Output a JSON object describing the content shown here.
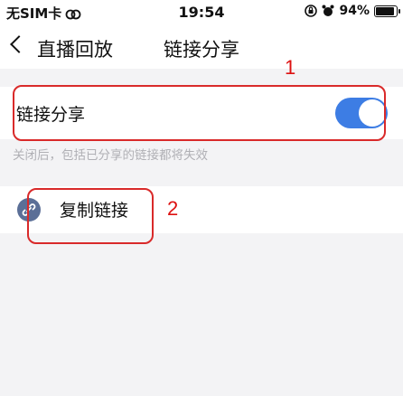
{
  "status_bar": {
    "carrier": "无SIM卡",
    "time": "19:54",
    "battery_percent": "94%",
    "battery_level": 0.94
  },
  "nav": {
    "back_label": "直播回放",
    "title": "链接分享"
  },
  "share": {
    "label": "链接分享",
    "enabled": true,
    "hint": "关闭后，包括已分享的链接都将失效"
  },
  "copy": {
    "label": "复制链接"
  },
  "annotations": {
    "num1": "1",
    "num2": "2"
  },
  "colors": {
    "toggle_on": "#3d7de4",
    "annotation": "#d92a2a",
    "icon_bg": "#5b6f97"
  }
}
